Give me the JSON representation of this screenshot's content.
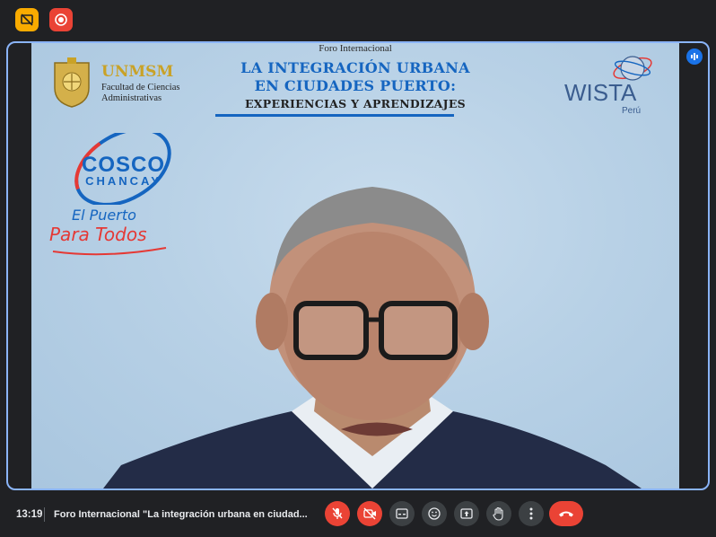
{
  "meeting": {
    "time": "13:19",
    "title": "Foro Internacional \"La integración urbana en ciudad..."
  },
  "banner": {
    "foro": "Foro Internacional",
    "title_line1": "LA INTEGRACIÓN URBANA",
    "title_line2": "EN CIUDADES PUERTO:",
    "title_line3": "EXPERIENCIAS Y APRENDIZAJES"
  },
  "unmsm": {
    "name": "UNMSM",
    "sub1": "Facultad de Ciencias",
    "sub2": "Administrativas"
  },
  "wista": {
    "name": "WISTA",
    "country": "Perú"
  },
  "cosco": {
    "word1": "COSCO",
    "word2": "CHANCAY",
    "slogan1": "El Puerto",
    "slogan2": "Para Todos"
  },
  "controls": [
    {
      "name": "microphone-off-icon",
      "state": "off"
    },
    {
      "name": "camera-off-icon",
      "state": "off"
    },
    {
      "name": "captions-icon",
      "state": "off"
    },
    {
      "name": "emoji-icon",
      "state": "off"
    },
    {
      "name": "present-icon",
      "state": "off"
    },
    {
      "name": "raise-hand-icon",
      "state": "off"
    },
    {
      "name": "more-options-icon",
      "state": "off"
    },
    {
      "name": "end-call-icon",
      "state": "end"
    }
  ],
  "colors": {
    "accent": "#8ab4f8",
    "danger": "#ea4335",
    "warning": "#f9ab00",
    "brand_blue": "#1565c0",
    "brand_red": "#e53935"
  }
}
